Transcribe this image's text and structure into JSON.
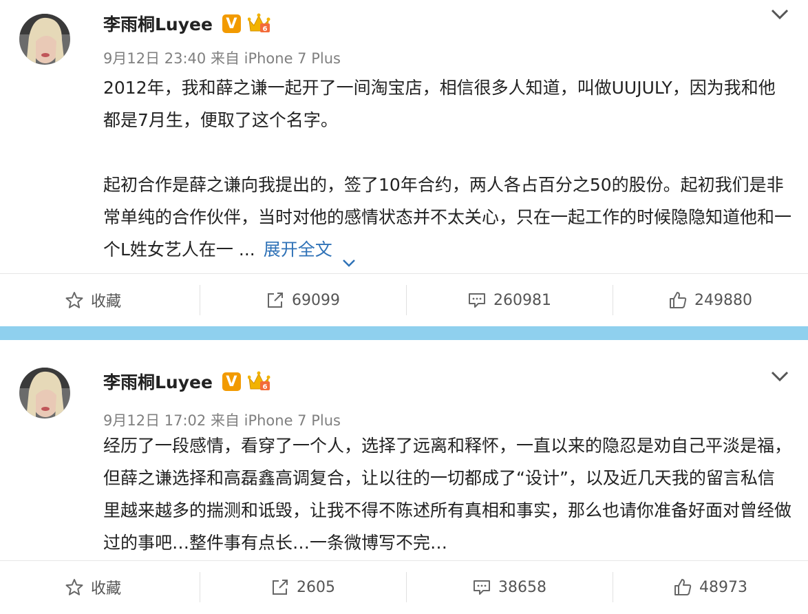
{
  "colors": {
    "accent_link": "#2f72b7",
    "divider": "#8fd0ee",
    "vip_badge": "#f29a00"
  },
  "posts": [
    {
      "author": "李雨桐Luyee",
      "verified_badge": "V",
      "meta": "9月12日 23:40 来自 iPhone 7 Plus",
      "paragraphs": [
        "2012年，我和薛之谦一起开了一间淘宝店，相信很多人知道，叫做UUJULY，因为我和他都是7月生，便取了这个名字。",
        "起初合作是薛之谦向我提出的，签了10年合约，两人各占百分之50的股份。起初我们是非常单纯的合作伙伴，当时对他的感情状态并不太关心，只在一起工作的时候隐隐知道他和一个L姓女艺人在一 ..."
      ],
      "expand_label": "展开全文",
      "actions": {
        "favorite": "收藏",
        "repost": "69099",
        "comment": "260981",
        "like": "249880"
      }
    },
    {
      "author": "李雨桐Luyee",
      "verified_badge": "V",
      "meta": "9月12日 17:02 来自 iPhone 7 Plus",
      "paragraphs": [
        "经历了一段感情，看穿了一个人，选择了远离和释怀，一直以来的隐忍是劝自己平淡是福，但薛之谦选择和高磊鑫高调复合，让以往的一切都成了“设计”，以及近几天我的留言私信里越来越多的揣测和诋毁，让我不得不陈述所有真相和事实，那么也请你准备好面对曾经做过的事吧…整件事有点长…一条微博写不完…"
      ],
      "actions": {
        "favorite": "收藏",
        "repost": "2605",
        "comment": "38658",
        "like": "48973"
      }
    }
  ]
}
